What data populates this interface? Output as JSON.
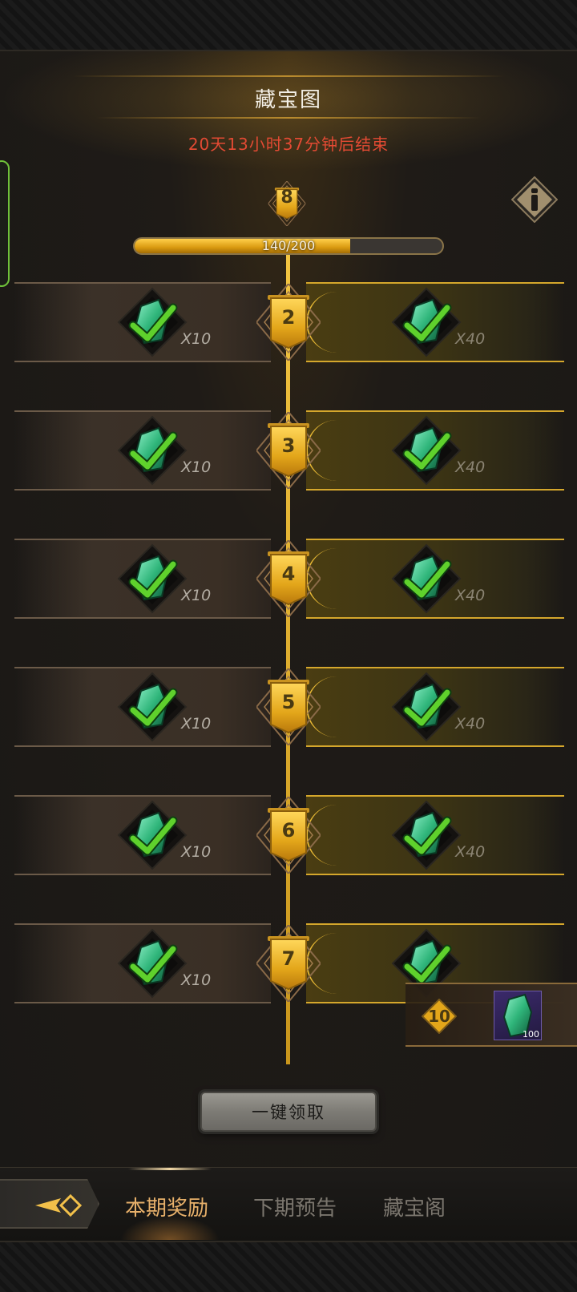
{
  "header": {
    "title": "藏宝图",
    "timer": "20天13小时37分钟后结束",
    "info_icon": "info-icon"
  },
  "level": {
    "current": "8"
  },
  "progress": {
    "text": "140/200",
    "current": 140,
    "max": 200
  },
  "reward_item_icon": "green-crystal-icon",
  "claimed_icon": "checkmark-icon",
  "rows": [
    {
      "level": "2",
      "free_qty": "X10",
      "premium_qty": "X40"
    },
    {
      "level": "3",
      "free_qty": "X10",
      "premium_qty": "X40"
    },
    {
      "level": "4",
      "free_qty": "X10",
      "premium_qty": "X40"
    },
    {
      "level": "5",
      "free_qty": "X10",
      "premium_qty": "X40"
    },
    {
      "level": "6",
      "free_qty": "X10",
      "premium_qty": "X40"
    },
    {
      "level": "7",
      "free_qty": "X10",
      "premium_qty": ""
    }
  ],
  "popup": {
    "level": "10",
    "count": "100"
  },
  "claim_all_label": "一键领取",
  "tabs": [
    {
      "label": "本期奖励",
      "active": true
    },
    {
      "label": "下期预告",
      "active": false
    },
    {
      "label": "藏宝阁",
      "active": false
    }
  ],
  "colors": {
    "accent_gold": "#e0b02f",
    "timer_red": "#e24a33",
    "check_green": "#5fd12c",
    "active_tab": "#e7b06a"
  }
}
